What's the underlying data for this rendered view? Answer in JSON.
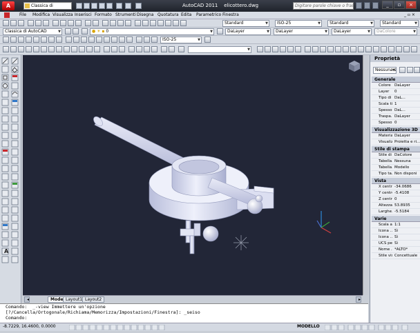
{
  "app": {
    "title": "AutoCAD 2011",
    "file": "elicottero.dwg",
    "workspace": "Classica di AutoCAD",
    "search_placeholder": "Digitare parole chiave o frase"
  },
  "menu": [
    "File",
    "Modifica",
    "Visualizza",
    "Inserisci",
    "Formato",
    "Strumenti",
    "Disegna",
    "Quotatura",
    "Edita",
    "Parametrico",
    "Finestra"
  ],
  "toolbar2": {
    "workspace_select": "Classica di AutoCAD",
    "layer_value": "0",
    "text_style": "Standard",
    "dim_style": "ISO-25",
    "table_style": "Standard",
    "mleader_style": "Standard"
  },
  "toolbar3": {
    "color": "DaLayer",
    "linetype": "DaLayer",
    "lineweight": "DaLayer",
    "plotstyle": "DaColore"
  },
  "toolbar4": {
    "dim_style": "ISO-25"
  },
  "layout_tabs": [
    "Modello",
    "Layout1",
    "Layout2"
  ],
  "command_lines": [
    "Comando:  _-view Immettere un'opzione",
    "[?/Cancella/Ortogonale/Richiama/Memorizza/Impostazioni/Finestra]: _seiso",
    "Comando:"
  ],
  "status": {
    "coords": "-8.7229, 16.4600, 0.0000",
    "model": "MODELLO"
  },
  "properties": {
    "title": "Proprietà",
    "selection": "Nessuna se",
    "sections": {
      "general": "Generale",
      "vis3d": "Visualizzazione 3D",
      "plot": "Stile di stampa",
      "view": "Vista",
      "misc": "Varie"
    },
    "general": [
      {
        "k": "Colore",
        "v": "DaLayer"
      },
      {
        "k": "Layer",
        "v": "0"
      },
      {
        "k": "Tipo di l...",
        "v": "DaL..."
      },
      {
        "k": "Scala ti...",
        "v": "1"
      },
      {
        "k": "Spesso...",
        "v": "DaL..."
      },
      {
        "k": "Traspa...",
        "v": "DaLayer"
      },
      {
        "k": "Spessore",
        "v": "0"
      }
    ],
    "vis3d": [
      {
        "k": "Materiale",
        "v": "DaLayer"
      },
      {
        "k": "Visualiz...",
        "v": "Proietta e ri..."
      }
    ],
    "plot": [
      {
        "k": "Stile di ...",
        "v": "DaColore"
      },
      {
        "k": "Tabella...",
        "v": "Nessuna"
      },
      {
        "k": "Tabella...",
        "v": "Modello"
      },
      {
        "k": "Tipo ta...",
        "v": "Non disponi"
      }
    ],
    "view": [
      {
        "k": "X centro",
        "v": "-34.0686"
      },
      {
        "k": "Y centro",
        "v": "-5.4108"
      },
      {
        "k": "Z centro",
        "v": "0"
      },
      {
        "k": "Altezza",
        "v": "53.8935"
      },
      {
        "k": "Larghe...",
        "v": "-5.5184"
      }
    ],
    "misc": [
      {
        "k": "Scala a...",
        "v": "1:1"
      },
      {
        "k": "Icona ...",
        "v": "Sì"
      },
      {
        "k": "Icona ...",
        "v": "Sì"
      },
      {
        "k": "UCS pe...",
        "v": "Sì"
      },
      {
        "k": "Nome ...",
        "v": "*ALTO*"
      },
      {
        "k": "Stile visi...",
        "v": "Concettuale"
      }
    ]
  },
  "colors": {
    "viewport_bg": "#222637",
    "titlebar": "#2a2e36",
    "accent_red": "#c8262b"
  }
}
